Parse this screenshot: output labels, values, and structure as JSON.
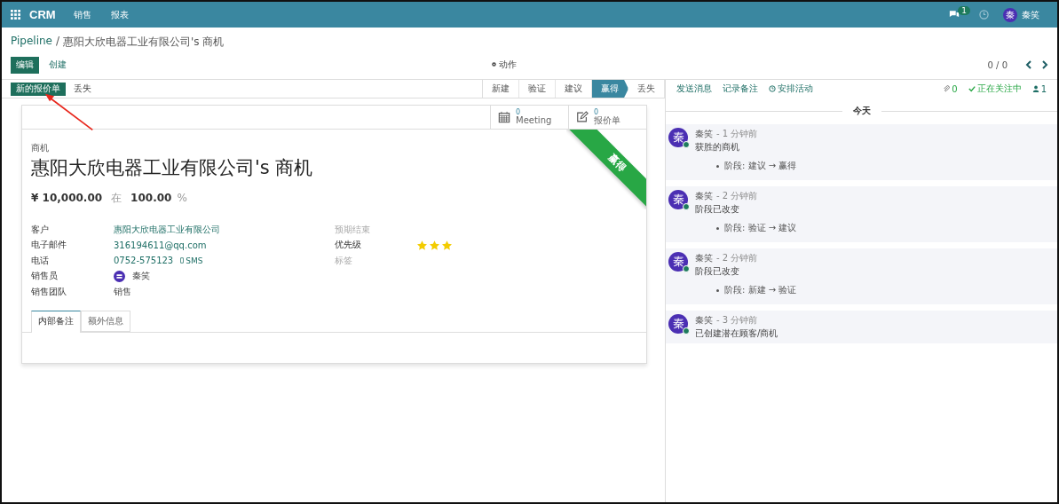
{
  "top_bar": {
    "app": "CRM",
    "menus": [
      "销售",
      "报表"
    ],
    "message_count": "1",
    "user": {
      "initial": "秦",
      "name": "秦笑"
    }
  },
  "breadcrumb": {
    "root": "Pipeline",
    "separator": "/",
    "current": "惠阳大欣电器工业有限公司's 商机"
  },
  "actions": {
    "edit": "编辑",
    "create": "创建",
    "action_menu": "动作",
    "pager": "0 / 0"
  },
  "status": {
    "buttons": [
      {
        "label": "新的报价单",
        "primary": true
      },
      {
        "label": "丢失",
        "primary": false
      }
    ],
    "stages": [
      {
        "label": "新建",
        "selected": false
      },
      {
        "label": "验证",
        "selected": false
      },
      {
        "label": "建议",
        "selected": false
      },
      {
        "label": "赢得",
        "selected": true
      },
      {
        "label": "丢失",
        "selected": false
      }
    ]
  },
  "stat_buttons": [
    {
      "kind": "calendar",
      "value": "0",
      "label": "Meeting"
    },
    {
      "kind": "edit",
      "value": "0",
      "label": "报价单"
    }
  ],
  "ribbon": "赢得",
  "record": {
    "type_label": "商机",
    "name": "惠阳大欣电器工业有限公司's 商机",
    "revenue": "¥ 10,000.00",
    "at": "在",
    "probability": "100.00",
    "percent": "%"
  },
  "left_fields": [
    {
      "label": "客户",
      "kind": "link",
      "value": "惠阳大欣电器工业有限公司"
    },
    {
      "label": "电子邮件",
      "kind": "link",
      "value": "316194611@qq.com"
    },
    {
      "label": "电话",
      "kind": "phone",
      "value": "0752-575123",
      "extra": "SMS"
    },
    {
      "label": "销售员",
      "kind": "user",
      "value": "秦笑"
    },
    {
      "label": "销售团队",
      "kind": "text",
      "value": "销售"
    }
  ],
  "right_fields": [
    {
      "label": "预期结束",
      "kind": "empty"
    },
    {
      "label": "优先级",
      "kind": "stars",
      "stars": 3
    },
    {
      "label": "标签",
      "kind": "empty"
    }
  ],
  "notebook": {
    "tabs": [
      {
        "label": "内部备注",
        "selected": true
      },
      {
        "label": "额外信息",
        "selected": false
      }
    ]
  },
  "chatter": {
    "actions": [
      "发送消息",
      "记录备注",
      "安排活动"
    ],
    "attachments": "0",
    "follow": "正在关注中",
    "followers": "1",
    "date_separator": "今天",
    "messages": [
      {
        "initial": "秦",
        "author": "秦笑",
        "time": "- 1 分钟前",
        "body": "获胜的商机",
        "changes": [
          "阶段: 建议 → 赢得"
        ]
      },
      {
        "initial": "秦",
        "author": "秦笑",
        "time": "- 2 分钟前",
        "body": "阶段已改变",
        "changes": [
          "阶段: 验证 → 建议"
        ]
      },
      {
        "initial": "秦",
        "author": "秦笑",
        "time": "- 2 分钟前",
        "body": "阶段已改变",
        "changes": [
          "阶段: 新建 → 验证"
        ]
      },
      {
        "initial": "秦",
        "author": "秦笑",
        "time": "- 3 分钟前",
        "body": "已创建潜在顾客/商机"
      }
    ]
  }
}
